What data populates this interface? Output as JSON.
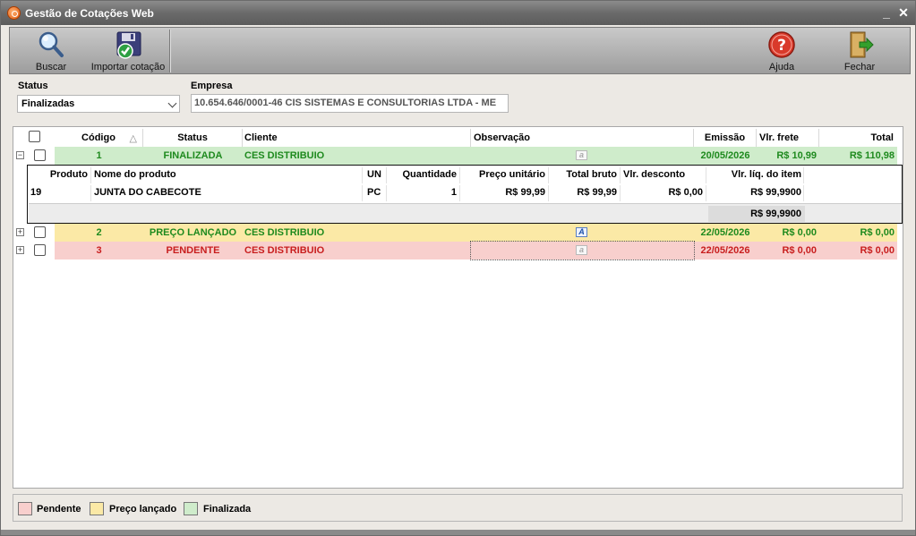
{
  "window": {
    "title": "Gestão de Cotações Web",
    "minimize": "_",
    "close": "✕"
  },
  "toolbar": {
    "buscar": "Buscar",
    "importar": "Importar cotação",
    "ajuda": "Ajuda",
    "fechar": "Fechar"
  },
  "filters": {
    "status_label": "Status",
    "status_value": "Finalizadas",
    "empresa_label": "Empresa",
    "empresa_value": "10.654.646/0001-46  CIS SISTEMAS E CONSULTORIAS LTDA - ME"
  },
  "grid": {
    "headers": {
      "codigo": "Código",
      "sort": "△",
      "status": "Status",
      "cliente": "Cliente",
      "observacao": "Observação",
      "emissao": "Emissão",
      "frete": "Vlr. frete",
      "total": "Total"
    },
    "rows": [
      {
        "expander": "−",
        "codigo": "1",
        "status": "FINALIZADA",
        "cliente": "CES DISTRIBUIO",
        "obs_icon": "a",
        "emissao": "20/05/2026",
        "frete": "R$ 10,99",
        "total": "R$ 110,98",
        "bg": "#cfeccb",
        "color": "#1e8a1e"
      },
      {
        "expander": "+",
        "codigo": "2",
        "status": "PREÇO LANÇADO",
        "cliente": "CES DISTRIBUIO",
        "obs_icon": "A",
        "emissao": "22/05/2026",
        "frete": "R$ 0,00",
        "total": "R$ 0,00",
        "bg": "#fbe9a6",
        "color": "#1e8a1e"
      },
      {
        "expander": "+",
        "codigo": "3",
        "status": "PENDENTE",
        "cliente": "CES DISTRIBUIO",
        "obs_icon": "a",
        "emissao": "22/05/2026",
        "frete": "R$ 0,00",
        "total": "R$ 0,00",
        "bg": "#f8cfcd",
        "color": "#c81e1e"
      }
    ],
    "detail": {
      "headers": {
        "produto": "Produto",
        "nome": "Nome do produto",
        "un": "UN",
        "quantidade": "Quantidade",
        "preco": "Preço unitário",
        "bruto": "Total bruto",
        "desconto": "Vlr. desconto",
        "liquido": "Vlr. líq. do item"
      },
      "item": {
        "produto": "19",
        "nome": "JUNTA DO CABECOTE",
        "un": "PC",
        "quantidade": "1",
        "preco": "R$ 99,99",
        "bruto": "R$ 99,99",
        "desconto": "R$ 0,00",
        "liquido": "R$ 99,9900"
      },
      "sum": "R$ 99,9900"
    }
  },
  "legend": {
    "pendente": "Pendente",
    "preco_lancado": "Preço lançado",
    "finalizada": "Finalizada",
    "colors": {
      "pendente": "#f8cfcd",
      "preco_lancado": "#fbe9a6",
      "finalizada": "#cfeccb"
    }
  }
}
